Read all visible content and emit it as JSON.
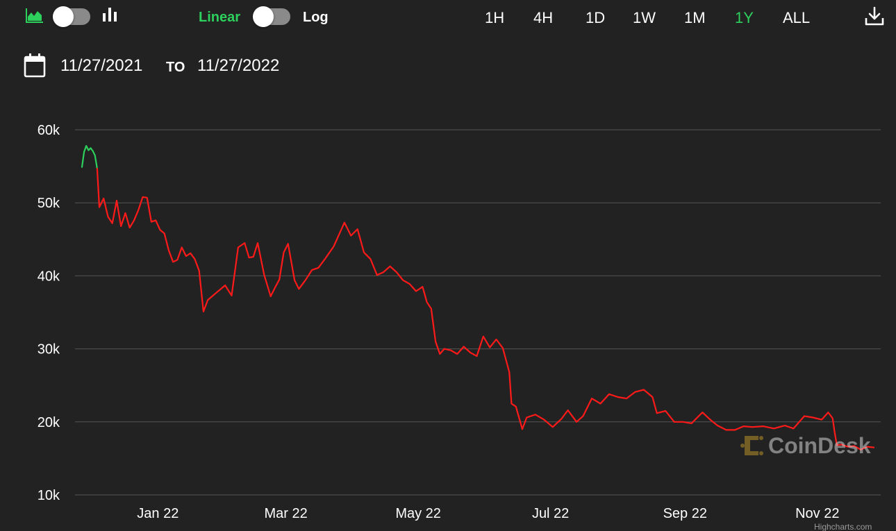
{
  "toolbar": {
    "scale_linear_label": "Linear",
    "scale_log_label": "Log",
    "ranges": [
      "1H",
      "4H",
      "1D",
      "1W",
      "1M",
      "1Y",
      "ALL"
    ],
    "active_range": "1Y"
  },
  "date_range": {
    "from": "11/27/2021",
    "to_label": "TO",
    "to": "11/27/2022"
  },
  "watermark": "CoinDesk",
  "credit": "Highcharts.com",
  "colors": {
    "background": "#222222",
    "accent": "#2dd05d",
    "line_up": "#2dd05d",
    "line_down": "#ff1a1a"
  },
  "chart_data": {
    "type": "line",
    "title": "",
    "xlabel": "",
    "ylabel": "",
    "grid": true,
    "y_ticks": [
      "10k",
      "20k",
      "30k",
      "40k",
      "50k",
      "60k"
    ],
    "ylim": [
      10000,
      60000
    ],
    "x_ticks": [
      "Jan 22",
      "Mar 22",
      "May 22",
      "Jul 22",
      "Sep 22",
      "Nov 22"
    ],
    "x_tick_dates": [
      "2022-01-01",
      "2022-03-01",
      "2022-05-01",
      "2022-07-01",
      "2022-09-01",
      "2022-11-01"
    ],
    "xlim": [
      "2021-11-27",
      "2022-11-27"
    ],
    "series": [
      {
        "color": "#2dd05d",
        "dates": [
          "2021-11-27",
          "2021-11-28",
          "2021-11-29",
          "2021-11-30",
          "2021-12-01",
          "2021-12-02",
          "2021-12-03",
          "2021-12-04"
        ],
        "values": [
          54900,
          57000,
          57800,
          57200,
          57500,
          57100,
          56500,
          54700
        ]
      },
      {
        "color": "#ff1a1a",
        "dates": [
          "2021-12-04",
          "2021-12-05",
          "2021-12-07",
          "2021-12-09",
          "2021-12-11",
          "2021-12-13",
          "2021-12-15",
          "2021-12-17",
          "2021-12-19",
          "2021-12-21",
          "2021-12-23",
          "2021-12-25",
          "2021-12-27",
          "2021-12-29",
          "2021-12-31",
          "2022-01-02",
          "2022-01-04",
          "2022-01-06",
          "2022-01-08",
          "2022-01-10",
          "2022-01-12",
          "2022-01-14",
          "2022-01-16",
          "2022-01-18",
          "2022-01-20",
          "2022-01-22",
          "2022-01-24",
          "2022-01-26",
          "2022-01-28",
          "2022-01-30",
          "2022-02-01",
          "2022-02-04",
          "2022-02-07",
          "2022-02-10",
          "2022-02-12",
          "2022-02-14",
          "2022-02-16",
          "2022-02-19",
          "2022-02-22",
          "2022-02-24",
          "2022-02-26",
          "2022-02-28",
          "2022-03-02",
          "2022-03-05",
          "2022-03-07",
          "2022-03-10",
          "2022-03-13",
          "2022-03-16",
          "2022-03-19",
          "2022-03-23",
          "2022-03-28",
          "2022-03-31",
          "2022-04-03",
          "2022-04-06",
          "2022-04-09",
          "2022-04-12",
          "2022-04-15",
          "2022-04-18",
          "2022-04-21",
          "2022-04-24",
          "2022-04-27",
          "2022-04-30",
          "2022-05-03",
          "2022-05-05",
          "2022-05-07",
          "2022-05-09",
          "2022-05-11",
          "2022-05-13",
          "2022-05-16",
          "2022-05-19",
          "2022-05-22",
          "2022-05-25",
          "2022-05-28",
          "2022-05-31",
          "2022-06-03",
          "2022-06-06",
          "2022-06-09",
          "2022-06-12",
          "2022-06-13",
          "2022-06-15",
          "2022-06-18",
          "2022-06-20",
          "2022-06-24",
          "2022-06-28",
          "2022-07-02",
          "2022-07-06",
          "2022-07-09",
          "2022-07-13",
          "2022-07-16",
          "2022-07-20",
          "2022-07-24",
          "2022-07-28",
          "2022-08-01",
          "2022-08-05",
          "2022-08-09",
          "2022-08-13",
          "2022-08-17",
          "2022-08-19",
          "2022-08-23",
          "2022-08-27",
          "2022-08-31",
          "2022-09-04",
          "2022-09-09",
          "2022-09-13",
          "2022-09-16",
          "2022-09-20",
          "2022-09-24",
          "2022-09-28",
          "2022-10-02",
          "2022-10-07",
          "2022-10-12",
          "2022-10-17",
          "2022-10-21",
          "2022-10-26",
          "2022-10-30",
          "2022-11-03",
          "2022-11-06",
          "2022-11-08",
          "2022-11-09",
          "2022-11-10",
          "2022-11-12",
          "2022-11-15",
          "2022-11-18",
          "2022-11-21",
          "2022-11-24",
          "2022-11-27"
        ],
        "values": [
          54700,
          49400,
          50600,
          48100,
          47200,
          50300,
          46800,
          48600,
          46600,
          47600,
          49000,
          50800,
          50700,
          47400,
          47600,
          46300,
          45800,
          43500,
          41900,
          42200,
          43900,
          42700,
          43100,
          42300,
          40700,
          35100,
          36700,
          37200,
          37700,
          38200,
          38700,
          37300,
          43900,
          44500,
          42500,
          42600,
          44500,
          40100,
          37200,
          38400,
          39500,
          43200,
          44400,
          39400,
          38200,
          39400,
          40800,
          41100,
          42300,
          44000,
          47300,
          45500,
          46400,
          43200,
          42300,
          40100,
          40500,
          41300,
          40500,
          39400,
          38900,
          37900,
          38500,
          36400,
          35500,
          31000,
          29300,
          30000,
          29800,
          29300,
          30300,
          29500,
          29000,
          31700,
          30200,
          31300,
          30100,
          26800,
          22500,
          22100,
          19000,
          20600,
          21000,
          20300,
          19300,
          20400,
          21600,
          20000,
          20800,
          23200,
          22500,
          23800,
          23400,
          23200,
          24100,
          24400,
          23400,
          21200,
          21500,
          20000,
          20000,
          19800,
          21300,
          20200,
          19500,
          18900,
          18900,
          19400,
          19300,
          19400,
          19100,
          19500,
          19100,
          20800,
          20600,
          20300,
          21300,
          20500,
          18500,
          16800,
          16900,
          16600,
          16700,
          16200,
          16600,
          16500
        ]
      }
    ]
  }
}
